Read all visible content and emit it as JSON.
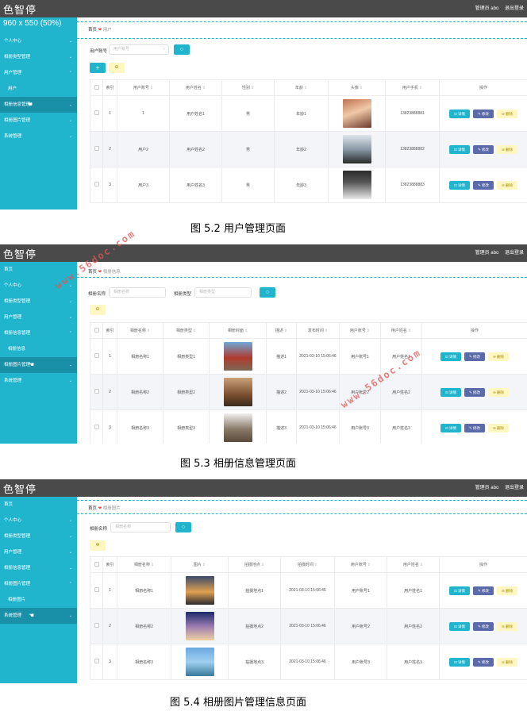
{
  "app": {
    "logo": "色智停",
    "admin_label": "管理员 abo",
    "logout_label": "退出登录"
  },
  "dim_overlay": "960 x 550 (50%)",
  "watermark": "www.56doc.com",
  "icons": {
    "chevron": "chevron-down-icon",
    "search": "magnifier-icon",
    "cursor": "hand-pointer-icon"
  },
  "colors": {
    "accent": "#21b5cd",
    "topbar": "#4a4a4a",
    "edit": "#5b6aa8",
    "delete_bg": "#fff7c2"
  },
  "screens": [
    {
      "caption": "图 5.2 用户管理页面",
      "sidebar": [
        {
          "label": "个人中心",
          "chev": "⌄"
        },
        {
          "label": "相册类型管理",
          "chev": "⌄"
        },
        {
          "label": "用户管理",
          "chev": "⌃"
        },
        {
          "label": "用户",
          "chev": ""
        },
        {
          "label": "相册信息管理",
          "chev": "⌄"
        },
        {
          "label": "相册图片管理",
          "chev": "⌄"
        },
        {
          "label": "系统管理",
          "chev": "⌄"
        }
      ],
      "breadcrumb": {
        "home": "首页",
        "current": "用户"
      },
      "search": [
        {
          "label": "用户账号",
          "placeholder": "用户账号"
        }
      ],
      "add_label": "+",
      "delete_label": "⊖",
      "columns": [
        "",
        "索引",
        "用户账号",
        "用户姓名",
        "性别",
        "年龄",
        "头像",
        "用户手机",
        "操作"
      ],
      "rows": [
        {
          "index": "1",
          "c1": "1",
          "c2": "用户姓名1",
          "c3": "男",
          "c4": "年龄1",
          "c6": "13823888881"
        },
        {
          "index": "2",
          "c1": "用户2",
          "c2": "用户姓名2",
          "c3": "男",
          "c4": "年龄2",
          "c6": "13823888882"
        },
        {
          "index": "3",
          "c1": "用户3",
          "c2": "用户姓名3",
          "c3": "男",
          "c4": "年龄3",
          "c6": "13823888883"
        }
      ],
      "ops": {
        "view": "⊡ 详情",
        "edit": "✎ 修改",
        "delete": "⊖ 删除"
      }
    },
    {
      "caption": "图 5.3 相册信息管理页面",
      "sidebar": [
        {
          "label": "首页",
          "chev": ""
        },
        {
          "label": "个人中心",
          "chev": "⌄"
        },
        {
          "label": "相册类型管理",
          "chev": "⌄"
        },
        {
          "label": "用户管理",
          "chev": "⌄"
        },
        {
          "label": "相册信息管理",
          "chev": "⌃"
        },
        {
          "label": "相册信息",
          "chev": ""
        },
        {
          "label": "相册图片管理",
          "chev": "⌄"
        },
        {
          "label": "系统管理",
          "chev": "⌄"
        }
      ],
      "breadcrumb": {
        "home": "首页",
        "current": "相册信息"
      },
      "search": [
        {
          "label": "相册名称",
          "placeholder": "相册名称"
        },
        {
          "label": "相册类型",
          "placeholder": "相册类型"
        }
      ],
      "add_label": "+",
      "delete_label": "⊖",
      "columns": [
        "",
        "索引",
        "相册名称",
        "相册类型",
        "相册封面",
        "描述",
        "发布时间",
        "用户账号",
        "用户姓名",
        "操作"
      ],
      "rows": [
        {
          "index": "1",
          "c1": "相册名称1",
          "c2": "相册类型1",
          "c4": "描述1",
          "c5": "2021-03-10 15:06:46",
          "c6": "用户账号1",
          "c7": "用户姓名1"
        },
        {
          "index": "2",
          "c1": "相册名称2",
          "c2": "相册类型2",
          "c4": "描述2",
          "c5": "2021-03-10 15:06:46",
          "c6": "用户账号2",
          "c7": "用户姓名2"
        },
        {
          "index": "3",
          "c1": "相册名称3",
          "c2": "相册类型3",
          "c4": "描述3",
          "c5": "2021-03-10 15:06:46",
          "c6": "用户账号3",
          "c7": "用户姓名3"
        }
      ],
      "ops": {
        "view": "⊡ 详情",
        "edit": "✎ 修改",
        "delete": "⊖ 删除"
      }
    },
    {
      "caption": "图 5.4 相册图片管理信息页面",
      "sidebar": [
        {
          "label": "首页",
          "chev": ""
        },
        {
          "label": "个人中心",
          "chev": "⌄"
        },
        {
          "label": "相册类型管理",
          "chev": "⌄"
        },
        {
          "label": "用户管理",
          "chev": "⌄"
        },
        {
          "label": "相册信息管理",
          "chev": "⌄"
        },
        {
          "label": "相册图片管理",
          "chev": "⌃"
        },
        {
          "label": "相册图片",
          "chev": ""
        },
        {
          "label": "系统管理",
          "chev": "⌄"
        }
      ],
      "breadcrumb": {
        "home": "首页",
        "current": "相册图片"
      },
      "search": [
        {
          "label": "相册名称",
          "placeholder": "相册名称"
        }
      ],
      "delete_label": "⊖",
      "columns": [
        "",
        "索引",
        "相册名称",
        "图片",
        "拍摄地点",
        "拍摄时间",
        "用户账号",
        "用户姓名",
        "操作"
      ],
      "rows": [
        {
          "index": "1",
          "c1": "相册名称1",
          "c3": "拍摄地点1",
          "c4": "2021-03-10 15:06:46",
          "c5": "用户账号1",
          "c6": "用户姓名1"
        },
        {
          "index": "2",
          "c1": "相册名称2",
          "c3": "拍摄地点2",
          "c4": "2021-03-10 15:06:46",
          "c5": "用户账号2",
          "c6": "用户姓名2"
        },
        {
          "index": "3",
          "c1": "相册名称3",
          "c3": "拍摄地点3",
          "c4": "2021-03-10 15:06:46",
          "c5": "用户账号3",
          "c6": "用户姓名3"
        }
      ],
      "ops": {
        "view": "⊡ 详情",
        "edit": "✎ 修改",
        "delete": "⊖ 删除"
      }
    }
  ]
}
